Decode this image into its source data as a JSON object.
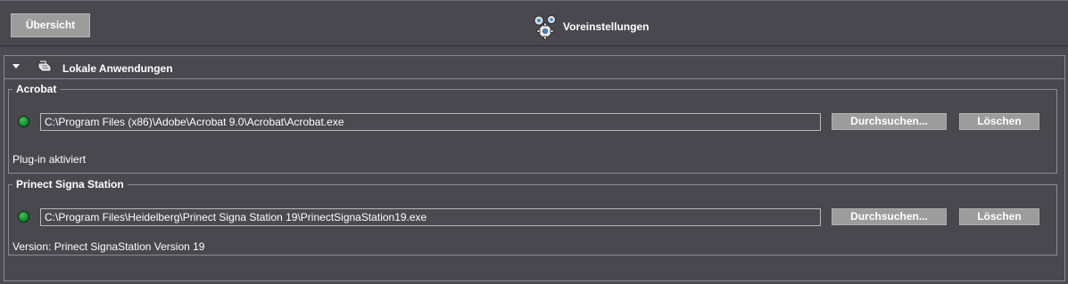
{
  "toolbar": {
    "overview_label": "Übersicht",
    "title": "Voreinstellungen"
  },
  "section": {
    "title": "Lokale Anwendungen"
  },
  "groups": [
    {
      "legend": "Acrobat",
      "path": "C:\\Program Files (x86)\\Adobe\\Acrobat 9.0\\Acrobat\\Acrobat.exe",
      "browse_label": "Durchsuchen...",
      "delete_label": "Löschen",
      "info": "Plug-in aktiviert",
      "status_color": "#1a8f32"
    },
    {
      "legend": "Prinect Signa Station",
      "path": "C:\\Program Files\\Heidelberg\\Prinect Signa Station 19\\PrinectSignaStation19.exe",
      "browse_label": "Durchsuchen...",
      "delete_label": "Löschen",
      "info": "Version: Prinect SignaStation Version 19",
      "status_color": "#1a8f32"
    }
  ],
  "colors": {
    "background": "#4a4a50",
    "button": "#9c9c9c",
    "border": "#8a8a90",
    "status_ok": "#1a8f32"
  }
}
